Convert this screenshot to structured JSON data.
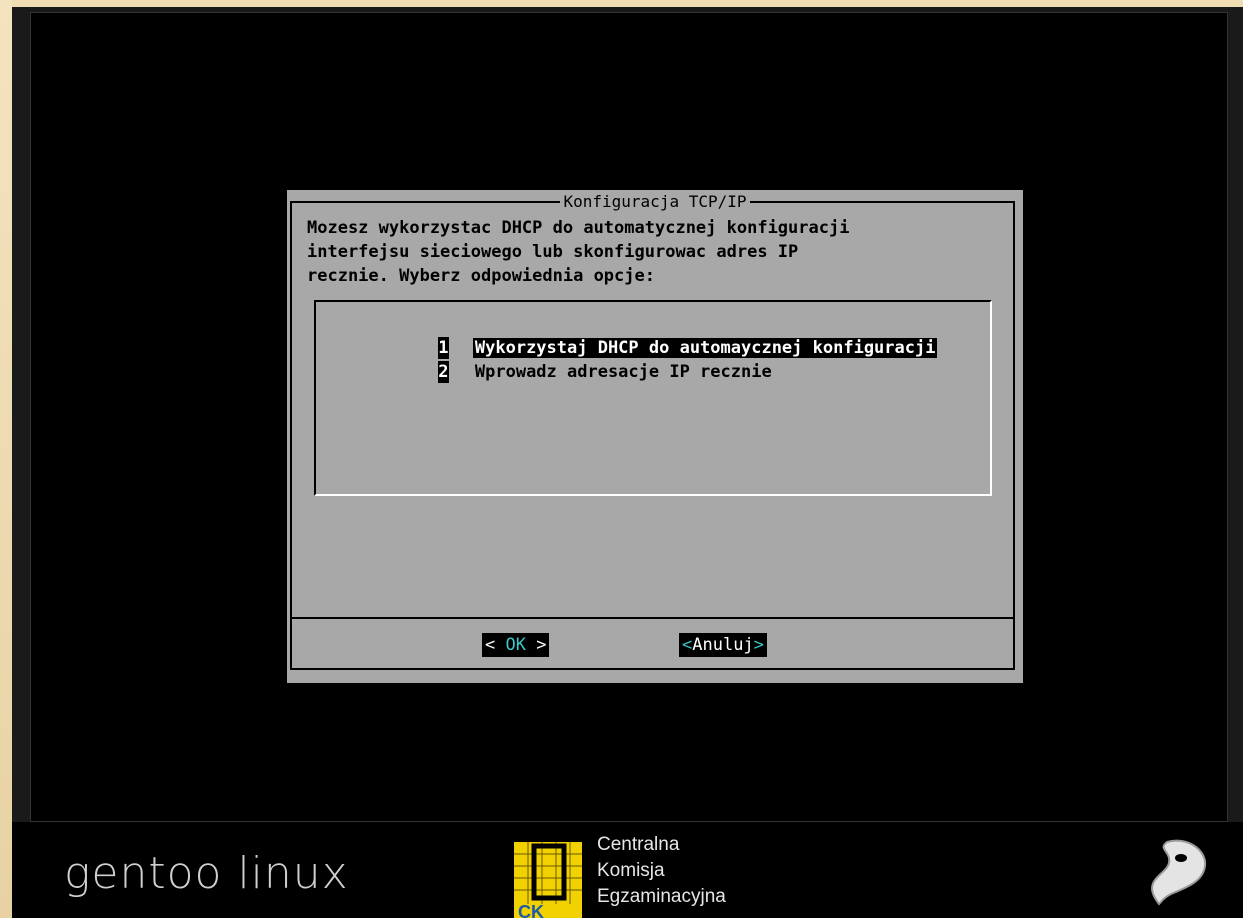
{
  "dialog": {
    "title": "Konfiguracja TCP/IP",
    "prompt_lines": [
      "Mozesz wykorzystac DHCP do automatycznej konfiguracji",
      "interfejsu sieciowego lub skonfigurowac adres IP",
      "recznie. Wyberz odpowiednia opcje:"
    ],
    "menu": [
      {
        "tag": "1",
        "label": "Wykorzystaj DHCP do automaycznej konfiguracji",
        "selected": true
      },
      {
        "tag": "2",
        "label": "Wprowadz adresacje IP recznie",
        "selected": false
      }
    ],
    "buttons": {
      "ok_left": "< ",
      "ok_label": "OK",
      "ok_right": " >",
      "cancel_left": "<",
      "cancel_label": "Anuluj",
      "cancel_right": ">"
    }
  },
  "branding": {
    "distro": "gentoo linux",
    "cke_lines": [
      "Centralna",
      "Komisja",
      "Egzaminacyjna"
    ],
    "cke_logo_text": "CK"
  },
  "colors": {
    "dialog_bg": "#a8a8a8",
    "screen_bg": "#000000",
    "button_accent": "#3cc6c6",
    "frame": "#f1ddb3"
  }
}
